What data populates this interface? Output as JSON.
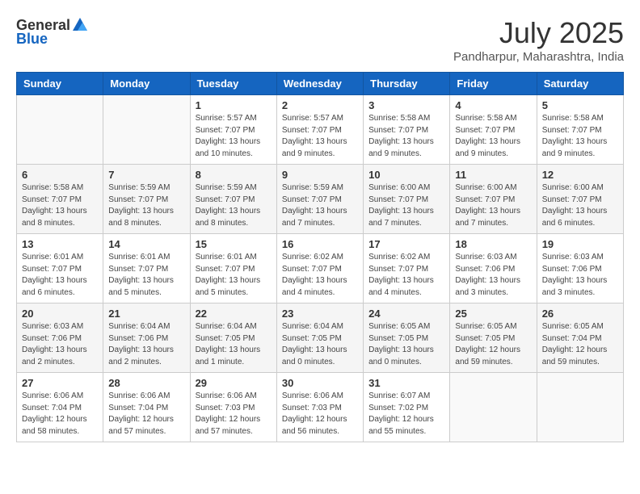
{
  "logo": {
    "general": "General",
    "blue": "Blue"
  },
  "title": {
    "month_year": "July 2025",
    "location": "Pandharpur, Maharashtra, India"
  },
  "weekdays": [
    "Sunday",
    "Monday",
    "Tuesday",
    "Wednesday",
    "Thursday",
    "Friday",
    "Saturday"
  ],
  "weeks": [
    [
      {
        "day": "",
        "info": ""
      },
      {
        "day": "",
        "info": ""
      },
      {
        "day": "1",
        "info": "Sunrise: 5:57 AM\nSunset: 7:07 PM\nDaylight: 13 hours\nand 10 minutes."
      },
      {
        "day": "2",
        "info": "Sunrise: 5:57 AM\nSunset: 7:07 PM\nDaylight: 13 hours\nand 9 minutes."
      },
      {
        "day": "3",
        "info": "Sunrise: 5:58 AM\nSunset: 7:07 PM\nDaylight: 13 hours\nand 9 minutes."
      },
      {
        "day": "4",
        "info": "Sunrise: 5:58 AM\nSunset: 7:07 PM\nDaylight: 13 hours\nand 9 minutes."
      },
      {
        "day": "5",
        "info": "Sunrise: 5:58 AM\nSunset: 7:07 PM\nDaylight: 13 hours\nand 9 minutes."
      }
    ],
    [
      {
        "day": "6",
        "info": "Sunrise: 5:58 AM\nSunset: 7:07 PM\nDaylight: 13 hours\nand 8 minutes."
      },
      {
        "day": "7",
        "info": "Sunrise: 5:59 AM\nSunset: 7:07 PM\nDaylight: 13 hours\nand 8 minutes."
      },
      {
        "day": "8",
        "info": "Sunrise: 5:59 AM\nSunset: 7:07 PM\nDaylight: 13 hours\nand 8 minutes."
      },
      {
        "day": "9",
        "info": "Sunrise: 5:59 AM\nSunset: 7:07 PM\nDaylight: 13 hours\nand 7 minutes."
      },
      {
        "day": "10",
        "info": "Sunrise: 6:00 AM\nSunset: 7:07 PM\nDaylight: 13 hours\nand 7 minutes."
      },
      {
        "day": "11",
        "info": "Sunrise: 6:00 AM\nSunset: 7:07 PM\nDaylight: 13 hours\nand 7 minutes."
      },
      {
        "day": "12",
        "info": "Sunrise: 6:00 AM\nSunset: 7:07 PM\nDaylight: 13 hours\nand 6 minutes."
      }
    ],
    [
      {
        "day": "13",
        "info": "Sunrise: 6:01 AM\nSunset: 7:07 PM\nDaylight: 13 hours\nand 6 minutes."
      },
      {
        "day": "14",
        "info": "Sunrise: 6:01 AM\nSunset: 7:07 PM\nDaylight: 13 hours\nand 5 minutes."
      },
      {
        "day": "15",
        "info": "Sunrise: 6:01 AM\nSunset: 7:07 PM\nDaylight: 13 hours\nand 5 minutes."
      },
      {
        "day": "16",
        "info": "Sunrise: 6:02 AM\nSunset: 7:07 PM\nDaylight: 13 hours\nand 4 minutes."
      },
      {
        "day": "17",
        "info": "Sunrise: 6:02 AM\nSunset: 7:07 PM\nDaylight: 13 hours\nand 4 minutes."
      },
      {
        "day": "18",
        "info": "Sunrise: 6:03 AM\nSunset: 7:06 PM\nDaylight: 13 hours\nand 3 minutes."
      },
      {
        "day": "19",
        "info": "Sunrise: 6:03 AM\nSunset: 7:06 PM\nDaylight: 13 hours\nand 3 minutes."
      }
    ],
    [
      {
        "day": "20",
        "info": "Sunrise: 6:03 AM\nSunset: 7:06 PM\nDaylight: 13 hours\nand 2 minutes."
      },
      {
        "day": "21",
        "info": "Sunrise: 6:04 AM\nSunset: 7:06 PM\nDaylight: 13 hours\nand 2 minutes."
      },
      {
        "day": "22",
        "info": "Sunrise: 6:04 AM\nSunset: 7:05 PM\nDaylight: 13 hours\nand 1 minute."
      },
      {
        "day": "23",
        "info": "Sunrise: 6:04 AM\nSunset: 7:05 PM\nDaylight: 13 hours\nand 0 minutes."
      },
      {
        "day": "24",
        "info": "Sunrise: 6:05 AM\nSunset: 7:05 PM\nDaylight: 13 hours\nand 0 minutes."
      },
      {
        "day": "25",
        "info": "Sunrise: 6:05 AM\nSunset: 7:05 PM\nDaylight: 12 hours\nand 59 minutes."
      },
      {
        "day": "26",
        "info": "Sunrise: 6:05 AM\nSunset: 7:04 PM\nDaylight: 12 hours\nand 59 minutes."
      }
    ],
    [
      {
        "day": "27",
        "info": "Sunrise: 6:06 AM\nSunset: 7:04 PM\nDaylight: 12 hours\nand 58 minutes."
      },
      {
        "day": "28",
        "info": "Sunrise: 6:06 AM\nSunset: 7:04 PM\nDaylight: 12 hours\nand 57 minutes."
      },
      {
        "day": "29",
        "info": "Sunrise: 6:06 AM\nSunset: 7:03 PM\nDaylight: 12 hours\nand 57 minutes."
      },
      {
        "day": "30",
        "info": "Sunrise: 6:06 AM\nSunset: 7:03 PM\nDaylight: 12 hours\nand 56 minutes."
      },
      {
        "day": "31",
        "info": "Sunrise: 6:07 AM\nSunset: 7:02 PM\nDaylight: 12 hours\nand 55 minutes."
      },
      {
        "day": "",
        "info": ""
      },
      {
        "day": "",
        "info": ""
      }
    ]
  ]
}
